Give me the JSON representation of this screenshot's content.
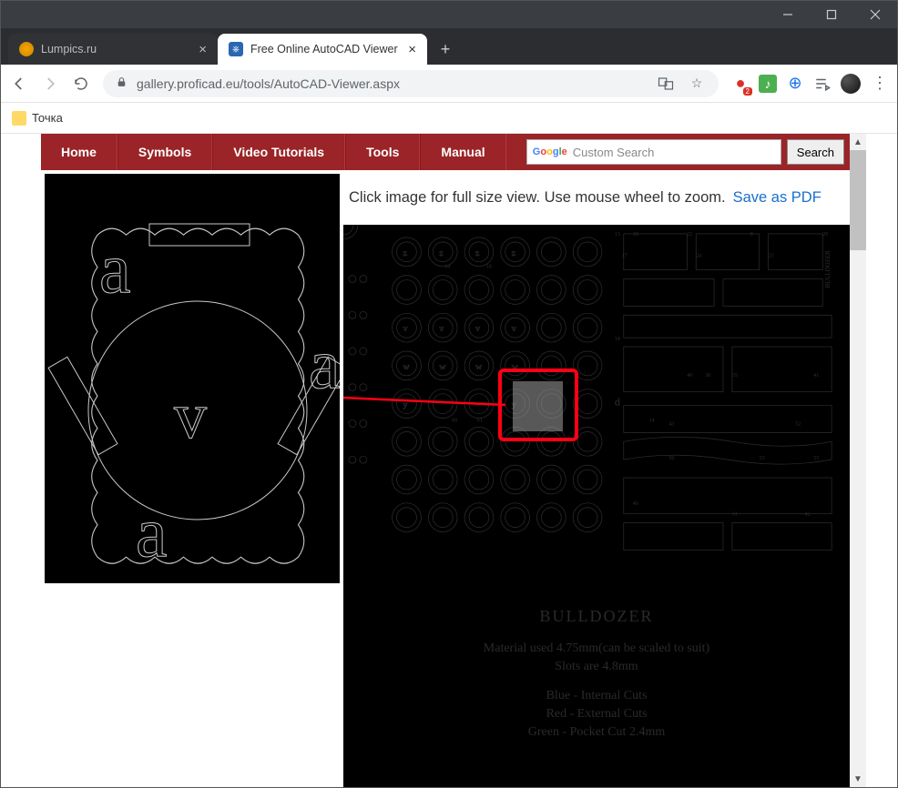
{
  "window": {
    "tabs": [
      {
        "title": "Lumpics.ru",
        "active": false
      },
      {
        "title": "Free Online AutoCAD Viewer",
        "active": true
      }
    ]
  },
  "address": {
    "secure_icon": "lock",
    "domain": "gallery.proficad.eu",
    "path": "/tools/AutoCAD-Viewer.aspx",
    "ext_badge": "2"
  },
  "bookmarks": [
    "Точка"
  ],
  "nav": {
    "items": [
      "Home",
      "Symbols",
      "Video Tutorials",
      "Tools",
      "Manual"
    ],
    "search_placeholder": "Custom Search",
    "search_btn": "Search"
  },
  "instructions": {
    "text": "Click image for full size view. Use mouse wheel to zoom.",
    "link": "Save as PDF"
  },
  "cad": {
    "title": "BULLDOZER",
    "line1": "Material used 4.75mm(can be scaled to suit)",
    "line2": "Slots are 4.8mm",
    "line3": "Blue - Internal Cuts",
    "line4": "Red - External Cuts",
    "line5": "Green - Pocket Cut 2.4mm",
    "d_label": "d",
    "bulldozer_v": "BULLDOZER"
  },
  "zoom": {
    "a": "a",
    "v": "v"
  }
}
